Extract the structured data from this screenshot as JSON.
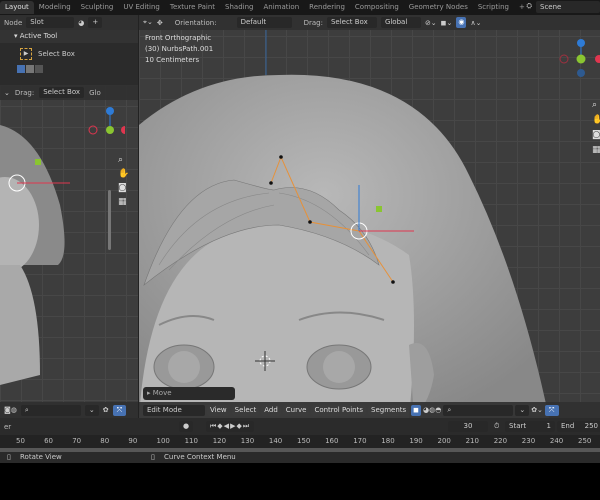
{
  "workspace_tabs": [
    "Layout",
    "Modeling",
    "Sculpting",
    "UV Editing",
    "Texture Paint",
    "Shading",
    "Animation",
    "Rendering",
    "Compositing",
    "Geometry Nodes",
    "Scripting"
  ],
  "add_tab": "+",
  "scene": "Scene",
  "left_header": {
    "node": "Node",
    "slot": "Slot",
    "add": "+"
  },
  "active_tool": {
    "title": "Active Tool",
    "tool": "Select Box"
  },
  "left_viewport_header": {
    "drag_label": "Drag:",
    "drag_value": "Select Box",
    "orientation_partial": "Glo"
  },
  "viewport_header": {
    "orientation_label": "Orientation:",
    "orientation_value": "Default",
    "drag_label": "Drag:",
    "drag_value": "Select Box",
    "pivot": "Global"
  },
  "viewport_info": {
    "view": "Front Orthographic",
    "object": "(30) NurbsPath.001",
    "scale": "10 Centimeters"
  },
  "gizmo": {
    "z": "Z",
    "y": "Y",
    "x": "X"
  },
  "operator_panel": "Move",
  "bottom_header": {
    "mode": "Edit Mode",
    "menus": [
      "View",
      "Select",
      "Add",
      "Curve",
      "Control Points",
      "Segments"
    ]
  },
  "timeline": {
    "label_partial": "er",
    "current_frame": "30",
    "start_label": "Start",
    "start": "1",
    "end_label": "End",
    "end": "250",
    "ticks": [
      "50",
      "60",
      "70",
      "80",
      "90",
      "100",
      "110",
      "120",
      "130",
      "140",
      "150",
      "160",
      "170",
      "180",
      "190",
      "200",
      "210",
      "220",
      "230",
      "240",
      "250"
    ]
  },
  "status_bar": {
    "left": "Rotate View",
    "middle": "Curve Context Menu"
  },
  "colors": {
    "accent": "#4772b3",
    "x_axis": "#e0364f",
    "y_axis": "#8ac531",
    "z_axis": "#2e7bd6",
    "curve": "#e6913a"
  }
}
